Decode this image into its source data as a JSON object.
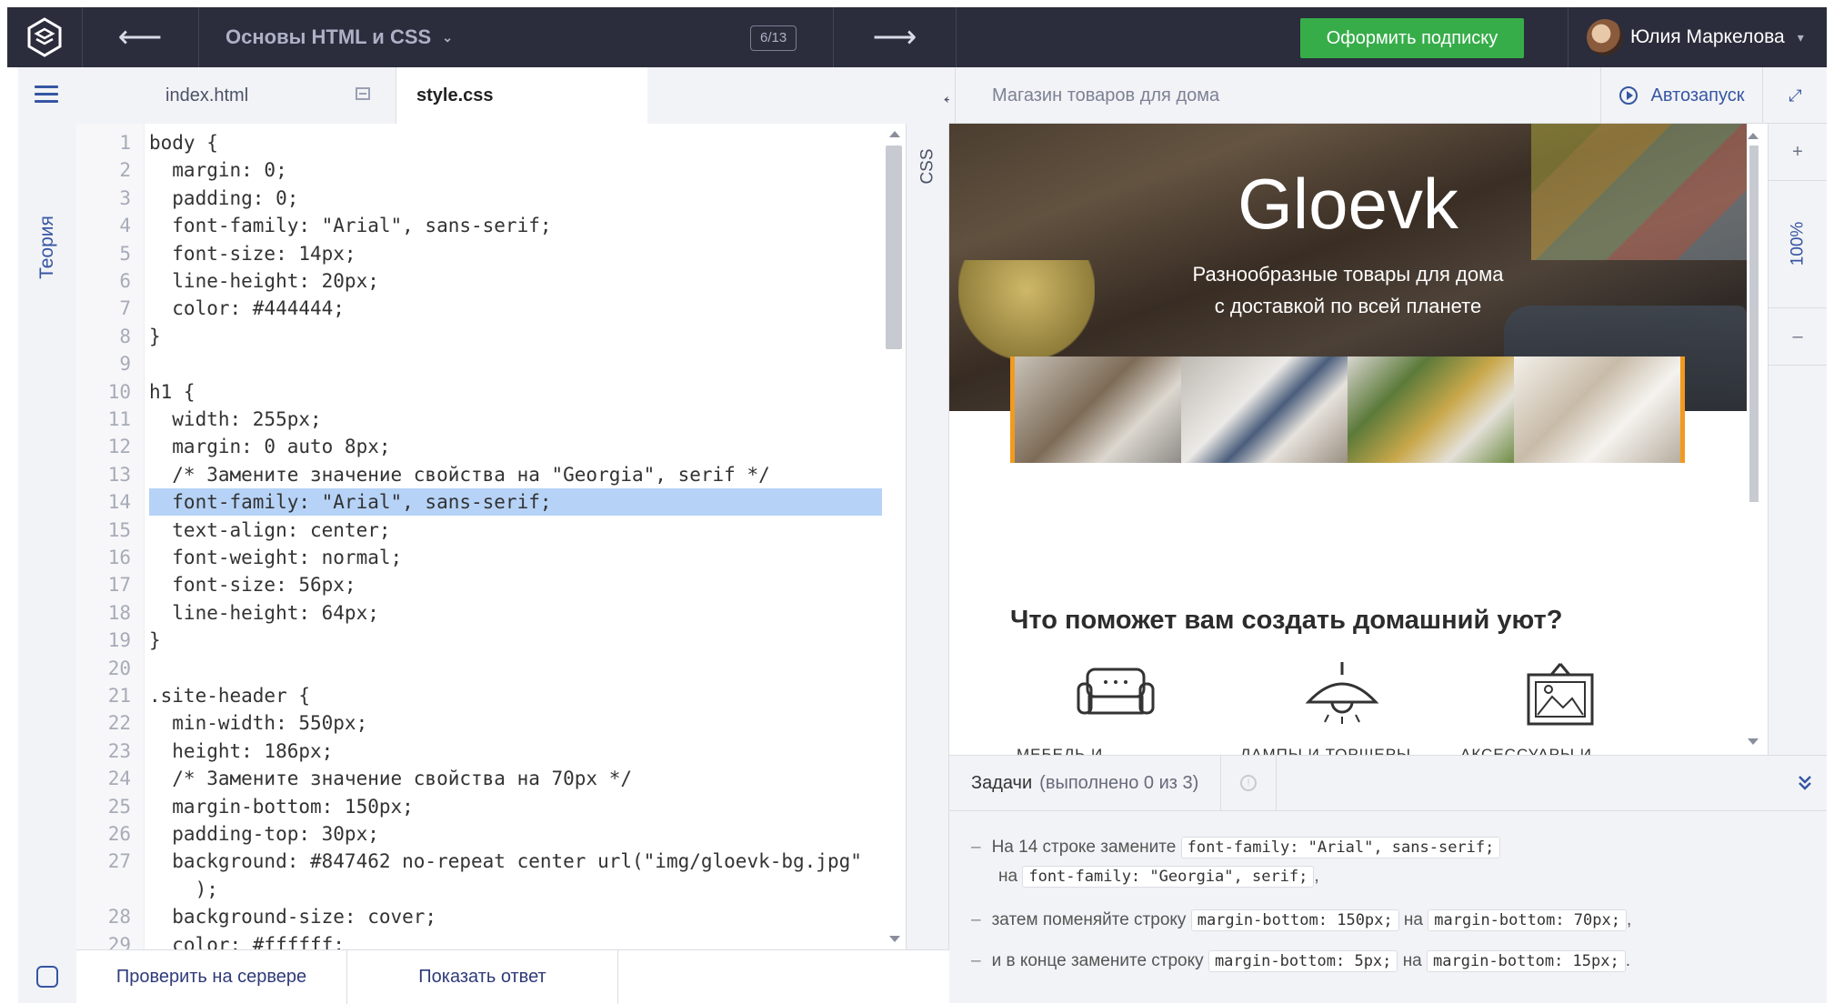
{
  "topbar": {
    "back_arrow": "⟵",
    "course_title": "Основы HTML и CSS",
    "course_chevron": "⌄",
    "progress": "6/13",
    "forward_arrow": "⟶",
    "subscribe_label": "Оформить подписку",
    "user_name": "Юлия Маркелова",
    "user_chevron": "▾"
  },
  "sidebar": {
    "theory_label": "Теория"
  },
  "editor": {
    "tabs": [
      {
        "label": "index.html",
        "active": false
      },
      {
        "label": "style.css",
        "active": true
      }
    ],
    "expand_icon": "↔",
    "css_tab_label": "CSS",
    "highlighted_line": 14,
    "lines": [
      {
        "n": "1",
        "t": "body {"
      },
      {
        "n": "2",
        "t": "  margin: 0;"
      },
      {
        "n": "3",
        "t": "  padding: 0;"
      },
      {
        "n": "4",
        "t": "  font-family: \"Arial\", sans-serif;"
      },
      {
        "n": "5",
        "t": "  font-size: 14px;"
      },
      {
        "n": "6",
        "t": "  line-height: 20px;"
      },
      {
        "n": "7",
        "t": "  color: #444444;"
      },
      {
        "n": "8",
        "t": "}"
      },
      {
        "n": "9",
        "t": ""
      },
      {
        "n": "10",
        "t": "h1 {"
      },
      {
        "n": "11",
        "t": "  width: 255px;"
      },
      {
        "n": "12",
        "t": "  margin: 0 auto 8px;"
      },
      {
        "n": "13",
        "t": "  /* Замените значение свойства на \"Georgia\", serif */"
      },
      {
        "n": "14",
        "t": "  font-family: \"Arial\", sans-serif;"
      },
      {
        "n": "15",
        "t": "  text-align: center;"
      },
      {
        "n": "16",
        "t": "  font-weight: normal;"
      },
      {
        "n": "17",
        "t": "  font-size: 56px;"
      },
      {
        "n": "18",
        "t": "  line-height: 64px;"
      },
      {
        "n": "19",
        "t": "}"
      },
      {
        "n": "20",
        "t": ""
      },
      {
        "n": "21",
        "t": ".site-header {"
      },
      {
        "n": "22",
        "t": "  min-width: 550px;"
      },
      {
        "n": "23",
        "t": "  height: 186px;"
      },
      {
        "n": "24",
        "t": "  /* Замените значение свойства на 70px */"
      },
      {
        "n": "25",
        "t": "  margin-bottom: 150px;"
      },
      {
        "n": "26",
        "t": "  padding-top: 30px;"
      },
      {
        "n": "27",
        "t": "  background: #847462 no-repeat center url(\"img/gloevk-bg.jpg\""
      },
      {
        "n": "",
        "t": "    );"
      },
      {
        "n": "28",
        "t": "  background-size: cover;"
      },
      {
        "n": "29",
        "t": "  color: #ffffff;"
      }
    ]
  },
  "actions": {
    "check_label": "Проверить на сервере",
    "answer_label": "Показать ответ"
  },
  "preview": {
    "title": "Магазин товаров для дома",
    "autorun_label": "Автозапуск",
    "fullscreen_icon": "⤢",
    "zoom_plus": "+",
    "zoom_level": "100%",
    "zoom_minus": "–",
    "site": {
      "name": "Gloevk",
      "tagline_line1": "Разнообразные товары для дома",
      "tagline_line2": "с доставкой по всей планете",
      "section_title": "Что поможет вам создать домашний уют?",
      "categories": [
        "МЕБЕЛЬ И",
        "ЛАМПЫ И ТОРШЕРЫ",
        "АКСЕССУАРЫ И"
      ]
    }
  },
  "tasks": {
    "title": "Задачи",
    "status": "(выполнено 0 из 3)",
    "collapse_icon": "⌄",
    "items": [
      {
        "prefix": "На 14 строке замените",
        "code1": "font-family: \"Arial\", sans-serif;",
        "mid": "на",
        "code2": "font-family: \"Georgia\", serif;",
        "suffix": ","
      },
      {
        "prefix": "затем поменяйте строку",
        "code1": "margin-bottom: 150px;",
        "mid": "на",
        "code2": "margin-bottom: 70px;",
        "suffix": ","
      },
      {
        "prefix": "и в конце замените строку",
        "code1": "margin-bottom: 5px;",
        "mid": "на",
        "code2": "margin-bottom: 15px;",
        "suffix": "."
      }
    ]
  },
  "colors": {
    "topbar": "#2b2d3c",
    "accent_blue": "#3656a3",
    "subscribe_green": "#37ad4a",
    "line_highlight": "#b6d3f7",
    "banner_border": "#f29a1f"
  }
}
